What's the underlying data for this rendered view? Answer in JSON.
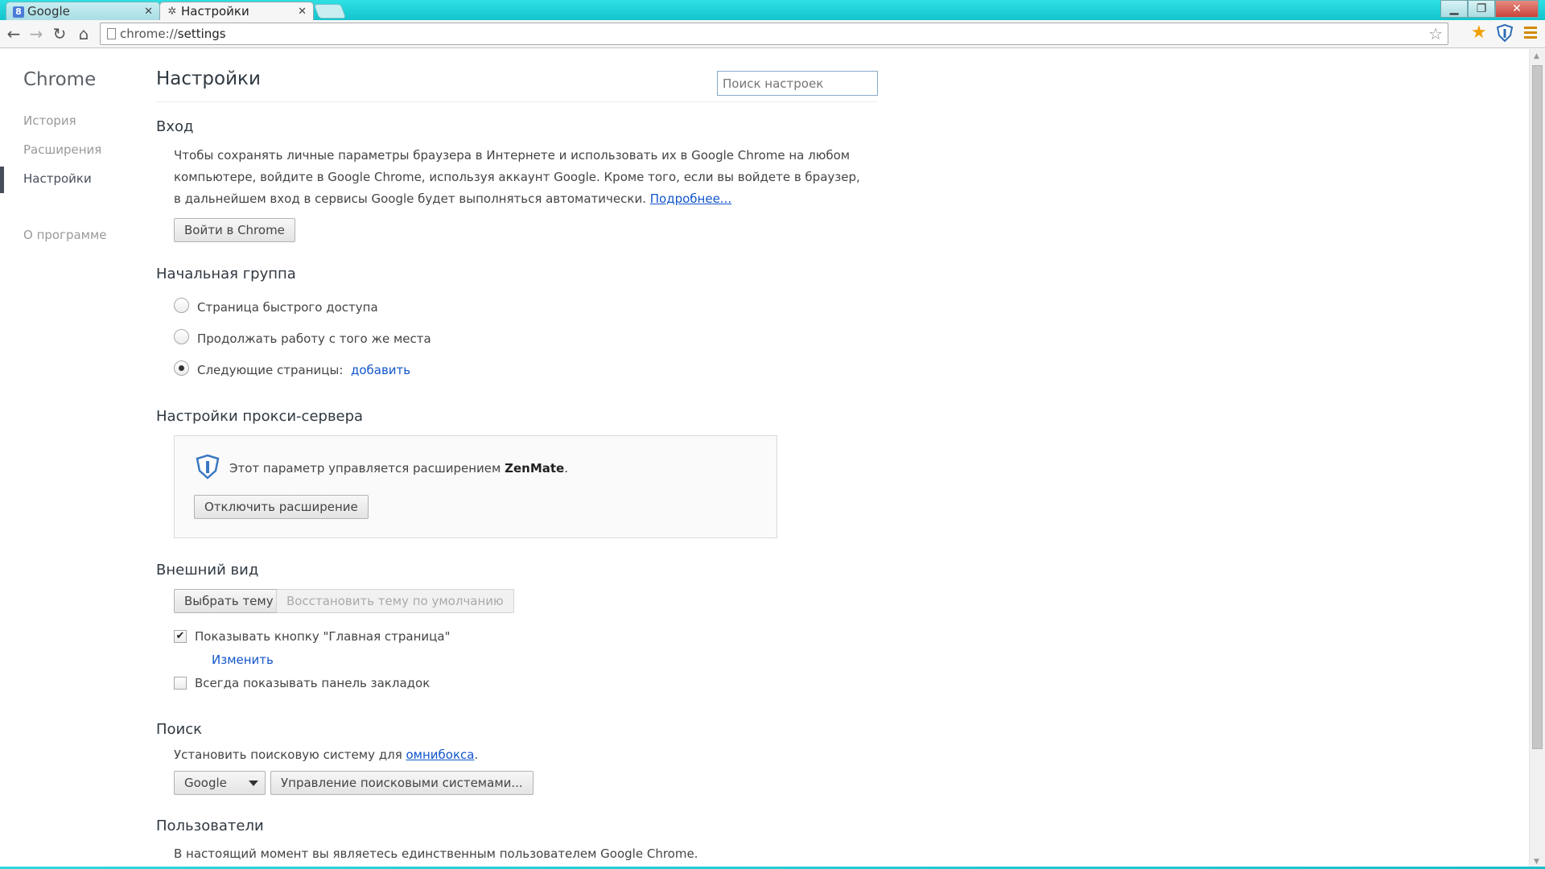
{
  "tabs": [
    {
      "title": "Google",
      "favicon": "8"
    },
    {
      "title": "Настройки",
      "favicon": "✲"
    }
  ],
  "window": {
    "minimize": "▁",
    "maximize": "❐",
    "close": "✕"
  },
  "toolbar": {
    "url_scheme": "chrome://",
    "url_path": "settings",
    "back": "←",
    "forward": "→",
    "reload": "↻",
    "home": "⌂",
    "bookmark_star": "☆",
    "extension_star": "★"
  },
  "sidebar": {
    "brand": "Chrome",
    "items": [
      {
        "label": "История"
      },
      {
        "label": "Расширения"
      },
      {
        "label": "Настройки"
      },
      {
        "label": "О программе"
      }
    ]
  },
  "page": {
    "title": "Настройки",
    "search_placeholder": "Поиск настроек"
  },
  "signin": {
    "heading": "Вход",
    "line1": "Чтобы сохранять личные параметры браузера в Интернете и использовать их в Google Chrome на любом",
    "line2": "компьютере, войдите в Google Chrome, используя аккаунт Google. Кроме того, если вы войдете в браузер,",
    "line3": "в дальнейшем вход в сервисы Google будет выполняться автоматически.",
    "more_link": "Подробнее...",
    "button": "Войти в Chrome"
  },
  "startup": {
    "heading": "Начальная группа",
    "options": [
      {
        "label": "Страница быстрого доступа",
        "checked": false
      },
      {
        "label": "Продолжать работу с того же места",
        "checked": false
      },
      {
        "label": "Следующие страницы:",
        "checked": true
      }
    ],
    "add_link": "добавить"
  },
  "proxy": {
    "heading": "Настройки прокси-сервера",
    "message": "Этот параметр управляется расширением",
    "extension_name": "ZenMate",
    "period": ".",
    "button": "Отключить расширение"
  },
  "appearance": {
    "heading": "Внешний вид",
    "choose_theme": "Выбрать тему",
    "reset_theme": "Восстановить тему по умолчанию",
    "show_home_label": "Показывать кнопку \"Главная страница\"",
    "show_home_checked": true,
    "change_link": "Изменить",
    "bookmarks_bar_label": "Всегда показывать панель закладок",
    "bookmarks_bar_checked": false
  },
  "search": {
    "heading": "Поиск",
    "text": "Установить поисковую систему для",
    "omnibox_link": "омнибокса",
    "period": ".",
    "engine": "Google",
    "manage_button": "Управление поисковыми системами..."
  },
  "users": {
    "heading": "Пользователи",
    "text": "В настоящий момент вы являетесь единственным пользователем Google Chrome."
  },
  "colors": {
    "titlebar": "#12c3cd",
    "link": "#1155cc",
    "extension_star": "#f0a000"
  }
}
